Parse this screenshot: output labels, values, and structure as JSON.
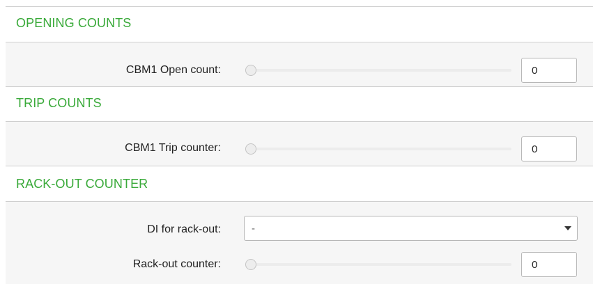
{
  "sections": {
    "opening": {
      "title": "OPENING COUNTS",
      "rows": [
        {
          "label": "CBM1 Open count:",
          "value": "0"
        }
      ]
    },
    "trip": {
      "title": "TRIP COUNTS",
      "rows": [
        {
          "label": "CBM1 Trip counter:",
          "value": "0"
        }
      ]
    },
    "rackout": {
      "title": "RACK-OUT COUNTER",
      "select": {
        "label": "DI for rack-out:",
        "value": "-"
      },
      "rows": [
        {
          "label": "Rack-out counter:",
          "value": "0"
        }
      ]
    }
  },
  "colors": {
    "section_title": "#3aaa3a",
    "divider": "#cfcfcf",
    "panel_bg": "#f6f6f6"
  },
  "icons": {
    "select_arrow": "chevron-down-icon",
    "slider_handle": "slider-handle"
  }
}
